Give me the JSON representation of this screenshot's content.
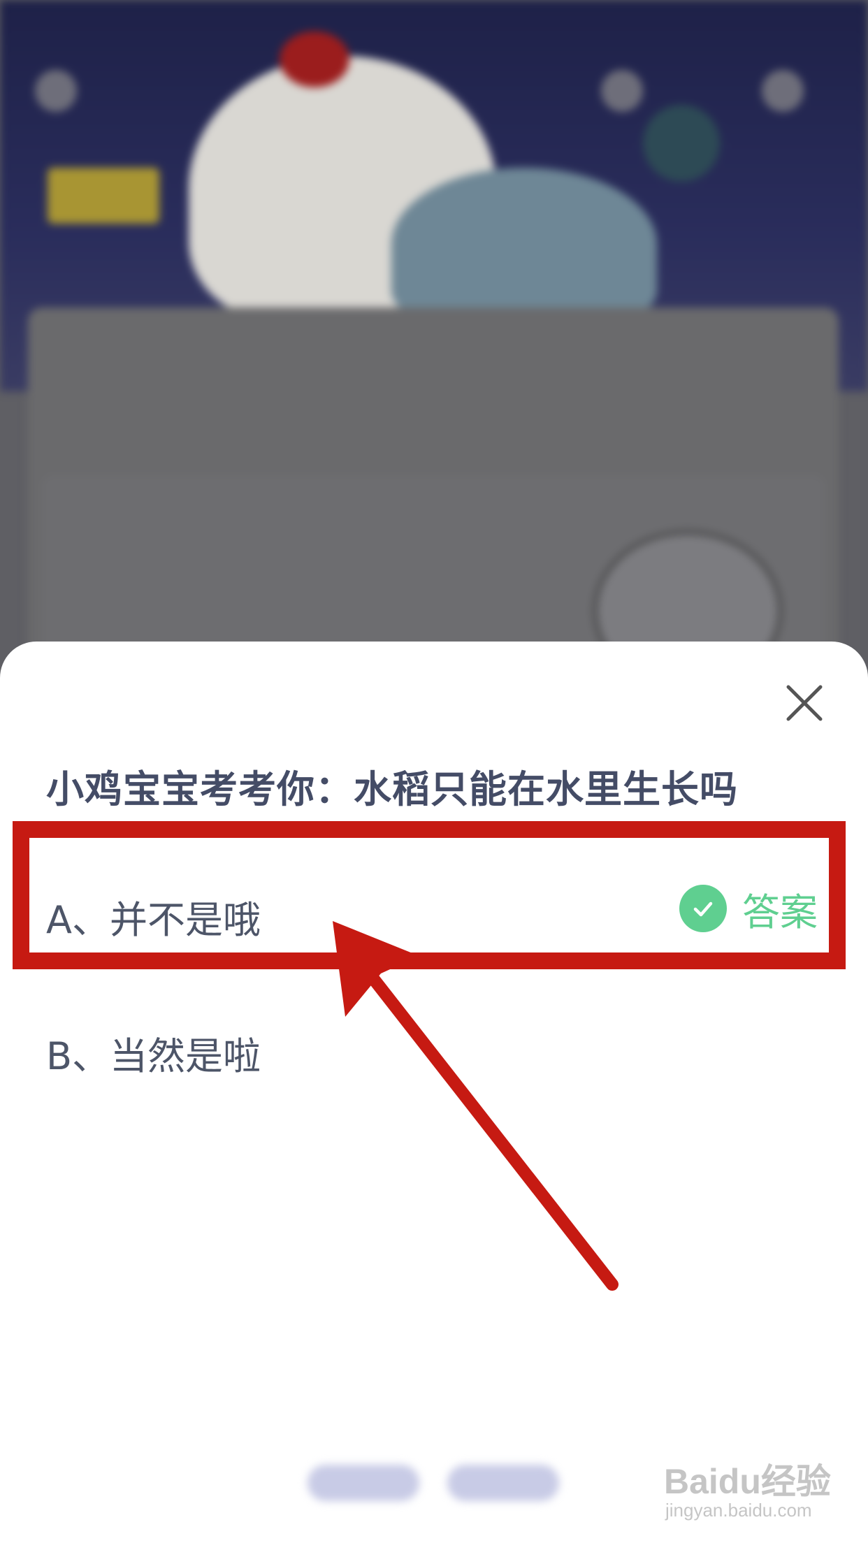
{
  "quiz": {
    "question": "小鸡宝宝考考你：水稻只能在水里生长吗",
    "options": [
      {
        "label": "A、并不是哦",
        "is_answer": true,
        "badge_text": "答案"
      },
      {
        "label": "B、当然是啦",
        "is_answer": false
      }
    ]
  },
  "colors": {
    "sheet_bg": "#ffffff",
    "question_text": "#444c66",
    "option_text": "#4d5568",
    "answer_green": "#5fcf90",
    "annotation_red": "#c61a12",
    "overlay_dim": "#5f5f64"
  },
  "icons": {
    "close": "close-icon",
    "answer_check": "check-circle-icon",
    "annotation_arrow": "arrow-annotation"
  },
  "watermark": {
    "logo": "Baidu经验",
    "url": "jingyan.baidu.com"
  }
}
